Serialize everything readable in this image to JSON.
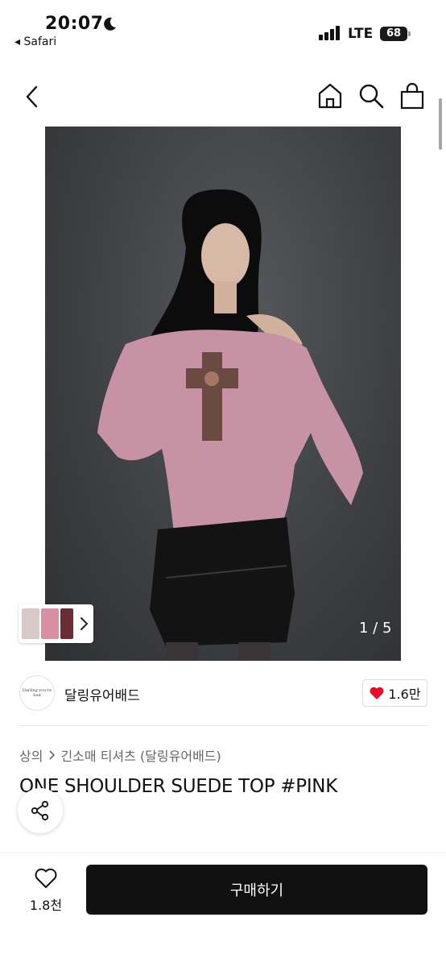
{
  "status_bar": {
    "time": "20:07",
    "back_app": "◂ Safari",
    "network": "LTE",
    "battery": "68"
  },
  "nav": {
    "icons": [
      "back-chevron-icon",
      "home-icon",
      "search-icon",
      "shopping-bag-icon"
    ]
  },
  "gallery": {
    "counter": "1 / 5",
    "thumbnail_colors": [
      "#d9c9c9",
      "#d88fa4",
      "#6a2d36"
    ]
  },
  "brand": {
    "logo_text": "Darling you're bad",
    "name": "달링유어배드",
    "likes": "1.6만"
  },
  "breadcrumb": {
    "category": "상의",
    "subcategory": "긴소매 티셔츠 (달링유어배드)"
  },
  "product": {
    "title": "ONE SHOULDER SUEDE TOP #PINK"
  },
  "bottom_bar": {
    "wish_count": "1.8천",
    "buy_label": "구매하기"
  },
  "colors": {
    "accent": "#111111",
    "heart": "#e0102a"
  }
}
